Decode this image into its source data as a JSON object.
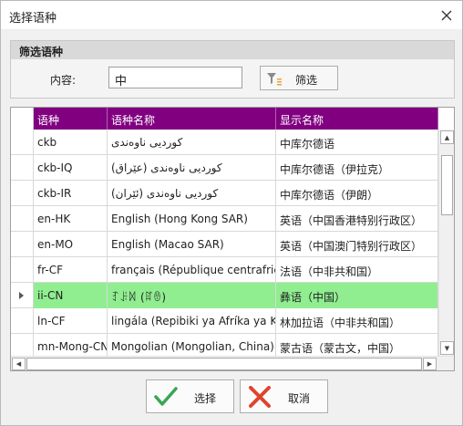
{
  "window": {
    "title": "选择语种"
  },
  "filter": {
    "heading": "筛选语种",
    "label": "内容:",
    "value": "中",
    "button": "筛选"
  },
  "grid": {
    "columns": [
      "语种",
      "语种名称",
      "显示名称"
    ],
    "rows": [
      {
        "code": "ckb",
        "native": "کوردیی ناوەندی",
        "display": "中库尔德语",
        "rtl": true
      },
      {
        "code": "ckb-IQ",
        "native": "کوردیی ناوەندی (عێراق)",
        "display": "中库尔德语（伊拉克）",
        "rtl": true
      },
      {
        "code": "ckb-IR",
        "native": "کوردیی ناوەندی (ئێران)",
        "display": "中库尔德语（伊朗）",
        "rtl": true
      },
      {
        "code": "en-HK",
        "native": "English (Hong Kong SAR)",
        "display": "英语（中国香港特别行政区）"
      },
      {
        "code": "en-MO",
        "native": "English (Macao SAR)",
        "display": "英语（中国澳门特别行政区）"
      },
      {
        "code": "fr-CF",
        "native": "français (République centrafric...",
        "display": "法语（中非共和国）"
      },
      {
        "code": "ii-CN",
        "native": "ꆈꌠꉙ (ꍏꇩ)",
        "display": "彝语（中国）",
        "selected": true
      },
      {
        "code": "ln-CF",
        "native": "lingála (Repibiki ya Afríka ya Káti)",
        "display": "林加拉语（中非共和国）"
      },
      {
        "code": "mn-Mong-CN",
        "native": "Mongolian (Mongolian, China)",
        "display": "蒙古语（蒙古文，中国）"
      }
    ]
  },
  "buttons": {
    "ok": "选择",
    "cancel": "取消"
  },
  "colors": {
    "header": "#800080",
    "selected_row": "#90ee90",
    "ok_icon": "#3aa653",
    "cancel_icon": "#e0442c"
  }
}
